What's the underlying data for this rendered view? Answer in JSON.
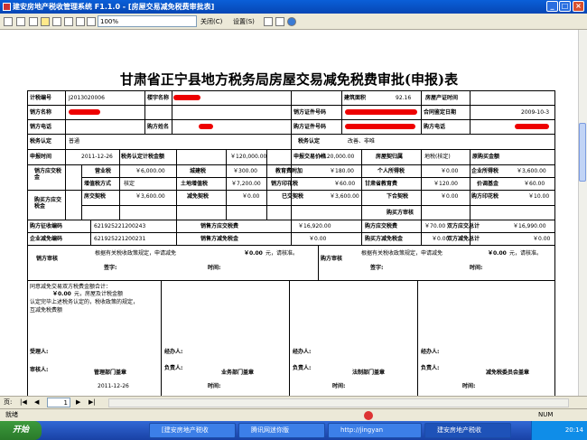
{
  "window": {
    "title": "建安房地产税收管理系统 F1.1.0 - [房屋交易减免税费审批表]",
    "min": "_",
    "max": "□",
    "close": "×"
  },
  "toolbar": {
    "zoom": "100%",
    "close": "关闭(C)",
    "settings": "设置(S)"
  },
  "doc": {
    "title": "甘肃省正宁县地方税务局房屋交易减免税费审批(申报)表",
    "r1": {
      "l1": "计税编号",
      "v1": "J2013020006",
      "l2": "楼宇名称",
      "l3": "建筑面积",
      "v3": "92.16",
      "l4": "房屋产证时间"
    },
    "r2": {
      "l1": "销方名称",
      "l3": "销方证件号码",
      "l4": "合同鉴定日期",
      "v4": "2009-10-3"
    },
    "r3": {
      "l1": "销方电话",
      "l2": "购方姓名",
      "l3": "购方证件号码",
      "l4": "购方电话"
    },
    "r4": {
      "l1": "税务认定",
      "v1": "普通",
      "l2": "税务认定",
      "v2": "改善、非唯"
    },
    "r5": {
      "l1": "申报时间",
      "v1": "2011-12-26",
      "l2": "税务认定计税金额",
      "v2": "￥120,000.00",
      "l3": "申报交易价格",
      "v3": "￥120,000.00",
      "l4": "房屋契归属",
      "v4": "地税(核定)",
      "l5": "原购买金额"
    },
    "seller": {
      "label": "销方应交税金",
      "a": {
        "k1": "营业税",
        "v1": "￥6,000.00",
        "k2": "城建税",
        "v2": "￥300.00",
        "k3": "教育费附加",
        "v3": "￥180.00",
        "k4": "个人所得税",
        "v4": "￥0.00",
        "k5": "企业所得税",
        "v5": "￥3,600.00"
      },
      "b": {
        "k1": "增值税方式",
        "v1": "核定",
        "k2": "土地增值税",
        "v2": "￥7,200.00",
        "k3": "销方印花税",
        "v3": "￥60.00",
        "k4": "甘肃省教育费",
        "v4": "￥120.00",
        "k5": "价调基金",
        "v5": "￥60.00"
      }
    },
    "buyer": {
      "label": "购买方应交税金",
      "a": {
        "k1": "房交契税",
        "v1": "￥3,600.00",
        "k2": "减免契税",
        "v2": "￥0.00",
        "k3": "已交契税",
        "v3": "￥3,600.00",
        "k4": "下合契税",
        "v4": "￥0.00",
        "k5": "购方印花税",
        "v5": "￥10.00"
      },
      "b": {
        "k1": "购买方审核"
      }
    },
    "p1": {
      "k1": "购方征收编码",
      "v1": "621925221200243",
      "k2": "销售方应交税费",
      "v2": "￥16,920.00",
      "k3": "购方应交税费",
      "v3": "￥70.00",
      "k4": "双方应交总计",
      "v4": "￥16,990.00"
    },
    "p2": {
      "k1": "企业减免编码",
      "v1": "621925221200231",
      "k2": "销售方减免税金",
      "v2": "￥0.00",
      "k3": "购买方减免税金",
      "v3": "￥0.00",
      "k4": "双方减免总计",
      "v4": "￥0.00"
    },
    "sopinion": {
      "label": "销方审核",
      "text": "根据有关税收政策规定，申请减免",
      "amount": "￥0.00",
      "unit": "元，请核准。",
      "sign": "签字:",
      "time": "时间:"
    },
    "bopinion": {
      "label": "购方审核",
      "text": "根据有关税收政策规定，申请减免",
      "amount": "￥0.00",
      "unit": "元，请核准。",
      "sign": "签字:",
      "time": "时间:"
    },
    "bottom": {
      "c1l1": "同意减免交易双方税费金额合计：",
      "c1amt": "￥0.00",
      "c1unit": "元，房屋及计税金额",
      "c1l3": "认定完毕上述税务认定的，税收政策的规定，",
      "c1l4": "互减免税费额",
      "handler": "受理人:",
      "reviewer": "审核人:",
      "date": "2011-12-26",
      "dept1": "管理部门盖章",
      "h2": "经办人:",
      "r2": "负责人:",
      "dept2": "业务部门盖章",
      "t2": "时间:",
      "h3": "经办人:",
      "r3": "负责人:",
      "dept3": "法制部门盖章",
      "t3": "时间:",
      "h4": "经办人:",
      "r4": "负责人:",
      "dept4": "减免税委员会盖章",
      "t4": "时间:"
    }
  },
  "pager": {
    "label": "页:",
    "page": "1"
  },
  "status": {
    "ready": "就绪",
    "num": "NUM"
  },
  "taskbar": {
    "start": "开始",
    "t1": "[建安房地产税收",
    "t2": "腾讯网迷你版",
    "t3": "http://jingyan",
    "t4": "建安房地产税收",
    "time": "20:14"
  }
}
